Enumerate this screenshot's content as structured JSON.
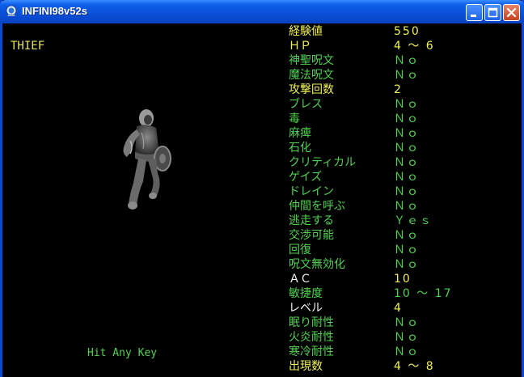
{
  "window": {
    "title": "INFINI98v52s"
  },
  "monster": {
    "class_name": "THIEF",
    "prompt": "Hit Any Key"
  },
  "stats": [
    {
      "label": "経験値",
      "value": "550",
      "color": "y"
    },
    {
      "label": "ＨＰ",
      "value": "4 ～ 6",
      "color": "y"
    },
    {
      "label": "神聖呪文",
      "value": "Ｎｏ",
      "color": "g"
    },
    {
      "label": "魔法呪文",
      "value": "Ｎｏ",
      "color": "g"
    },
    {
      "label": "攻撃回数",
      "value": "2",
      "color": "y"
    },
    {
      "label": "ブレス",
      "value": "Ｎｏ",
      "color": "g"
    },
    {
      "label": "毒",
      "value": "Ｎｏ",
      "color": "g"
    },
    {
      "label": "麻痺",
      "value": "Ｎｏ",
      "color": "g"
    },
    {
      "label": "石化",
      "value": "Ｎｏ",
      "color": "g"
    },
    {
      "label": "クリティカル",
      "value": "Ｎｏ",
      "color": "g"
    },
    {
      "label": "ゲイズ",
      "value": "Ｎｏ",
      "color": "g"
    },
    {
      "label": "ドレイン",
      "value": "Ｎｏ",
      "color": "g"
    },
    {
      "label": "仲間を呼ぶ",
      "value": "Ｎｏ",
      "color": "g"
    },
    {
      "label": "逃走する",
      "value": "Ｙｅｓ",
      "color": "g"
    },
    {
      "label": "交渉可能",
      "value": "Ｎｏ",
      "color": "g"
    },
    {
      "label": "回復",
      "value": "Ｎｏ",
      "color": "g"
    },
    {
      "label": "呪文無効化",
      "value": "Ｎｏ",
      "color": "g"
    },
    {
      "label": "ＡＣ",
      "value": "10",
      "color": "w"
    },
    {
      "label": "敏捷度",
      "value": "10 ～ 17",
      "color": "g"
    },
    {
      "label": "レベル",
      "value": "4",
      "color": "w"
    },
    {
      "label": "眠り耐性",
      "value": "Ｎｏ",
      "color": "g"
    },
    {
      "label": "火炎耐性",
      "value": "Ｎｏ",
      "color": "g"
    },
    {
      "label": "寒冷耐性",
      "value": "Ｎｏ",
      "color": "g"
    },
    {
      "label": "出現数",
      "value": "4 ～ 8",
      "color": "y"
    }
  ],
  "icons": {
    "app": "globe-app-icon",
    "minimize": "minimize-icon",
    "maximize": "maximize-icon",
    "close": "close-icon"
  }
}
